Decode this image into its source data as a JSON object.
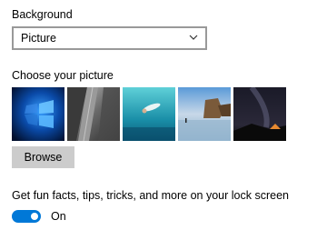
{
  "background": {
    "label": "Background",
    "selected": "Picture"
  },
  "picture": {
    "label": "Choose your picture",
    "thumbnails": [
      {
        "name": "windows-logo-thumbnail"
      },
      {
        "name": "rock-cliff-thumbnail"
      },
      {
        "name": "underwater-swimmer-thumbnail"
      },
      {
        "name": "beach-rocks-thumbnail"
      },
      {
        "name": "night-sky-tent-thumbnail"
      }
    ],
    "browse_label": "Browse"
  },
  "fun_facts": {
    "label": "Get fun facts, tips, tricks, and more on your lock screen",
    "state": "On",
    "enabled": true,
    "accent_color": "#0078d7"
  }
}
